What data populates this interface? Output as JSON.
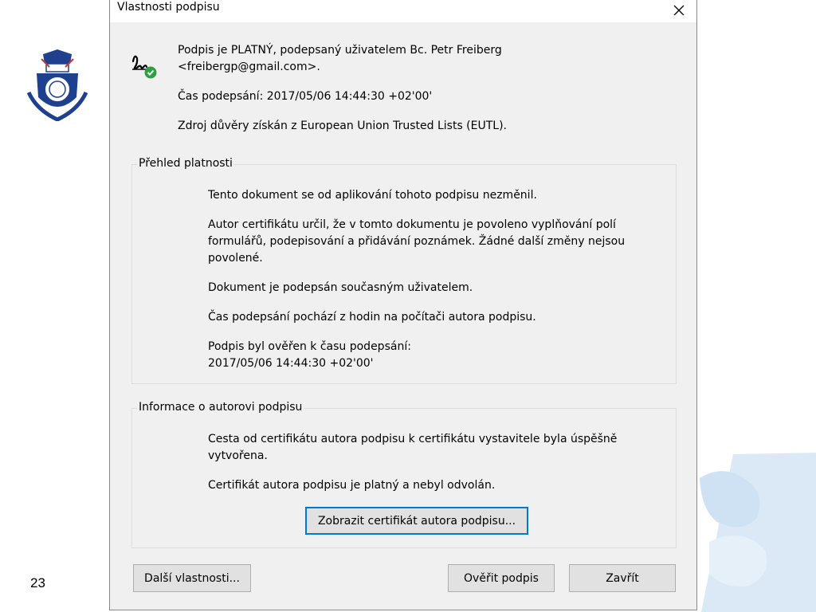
{
  "dialog": {
    "title": "Vlastnosti podpisu",
    "signature_status_line1": "Podpis je PLATNÝ, podepsaný uživatelem Bc. Petr Freiberg",
    "signature_status_line2": "<freibergp@gmail.com>.",
    "signing_time": "Čas podepsání:  2017/05/06 14:44:30 +02'00'",
    "trust_source": "Zdroj důvěry získán z European Union Trusted Lists (EUTL)."
  },
  "validity": {
    "label": "Přehled platnosti",
    "line1": "Tento dokument se od aplikování tohoto podpisu nezměnil.",
    "line2a": "Autor certifikátu určil, že v tomto dokumentu je povoleno vyplňování polí",
    "line2b": "formulářů, podepisování a přidávání poznámek. Žádné další změny nejsou",
    "line2c": "povolené.",
    "line3": "Dokument je podepsán současným uživatelem.",
    "line4": "Čas podepsání pochází z hodin na počítači autora podpisu.",
    "line5a": "Podpis byl ověřen k času podepsání:",
    "line5b": "2017/05/06 14:44:30 +02'00'"
  },
  "signer": {
    "label": "Informace o autorovi podpisu",
    "line1a": "Cesta od certifikátu autora podpisu k certifikátu vystavitele byla úspěšně",
    "line1b": "vytvořena.",
    "line2": "Certifikát autora podpisu je platný a nebyl odvolán.",
    "show_cert_button": "Zobrazit certifikát autora podpisu..."
  },
  "footer": {
    "more_props_button": "Další vlastnosti...",
    "verify_button": "Ověřit podpis",
    "close_button": "Zavřít"
  },
  "slide": {
    "page_number": "23"
  },
  "icons": {
    "close": "close-icon",
    "signature": "signature-valid-icon",
    "logo": "university-crest-logo"
  },
  "colors": {
    "accent": "#0078d7",
    "valid_green": "#2ea043",
    "dialog_bg": "#f0f0f0"
  }
}
